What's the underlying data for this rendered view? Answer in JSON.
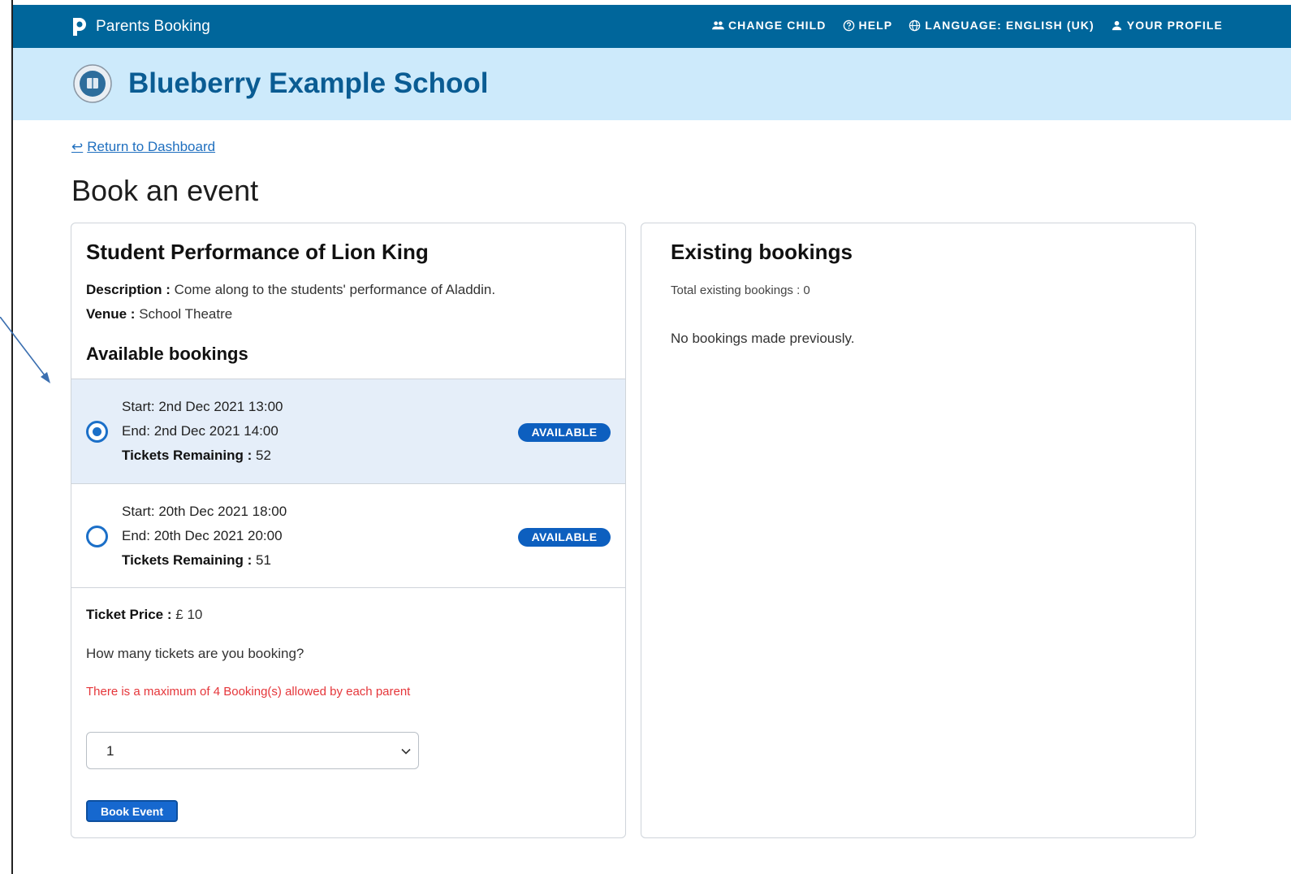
{
  "topbar": {
    "brand_name": "Parents Booking",
    "nav": [
      {
        "label": "CHANGE CHILD",
        "icon": "people-icon"
      },
      {
        "label": "HELP",
        "icon": "help-icon"
      },
      {
        "label": "LANGUAGE: ENGLISH (UK)",
        "icon": "globe-icon"
      },
      {
        "label": "YOUR PROFILE",
        "icon": "user-icon"
      }
    ]
  },
  "school": {
    "name": "Blueberry Example School"
  },
  "nav": {
    "return_label": "Return to Dashboard",
    "return_arrow": "↩"
  },
  "page": {
    "title": "Book an event"
  },
  "event": {
    "title": "Student Performance of Lion King",
    "description_label": "Description :",
    "description": "Come along to the students' performance of Aladdin.",
    "venue_label": "Venue :",
    "venue": "School Theatre",
    "available_title": "Available bookings",
    "slots": [
      {
        "start": "Start: 2nd Dec 2021 13:00",
        "end": "End: 2nd Dec 2021 14:00",
        "tickets_label": "Tickets Remaining :",
        "tickets": "52",
        "status": "AVAILABLE",
        "selected": true
      },
      {
        "start": "Start: 20th Dec 2021 18:00",
        "end": "End: 20th Dec 2021 20:00",
        "tickets_label": "Tickets Remaining :",
        "tickets": "51",
        "status": "AVAILABLE",
        "selected": false
      }
    ],
    "price_label": "Ticket Price :",
    "price": "£ 10",
    "question": "How many tickets are you booking?",
    "warning": "There is a maximum of 4 Booking(s) allowed by each parent",
    "quantity_selected": "1",
    "book_button": "Book Event"
  },
  "existing": {
    "title": "Existing bookings",
    "total": "Total existing bookings : 0",
    "none_message": "No bookings made previously."
  },
  "colors": {
    "topbar": "#00669b",
    "school_band": "#cdeafb",
    "selected_slot": "#e5eef9",
    "accent": "#1b6fc8",
    "warning": "#e5363a"
  }
}
